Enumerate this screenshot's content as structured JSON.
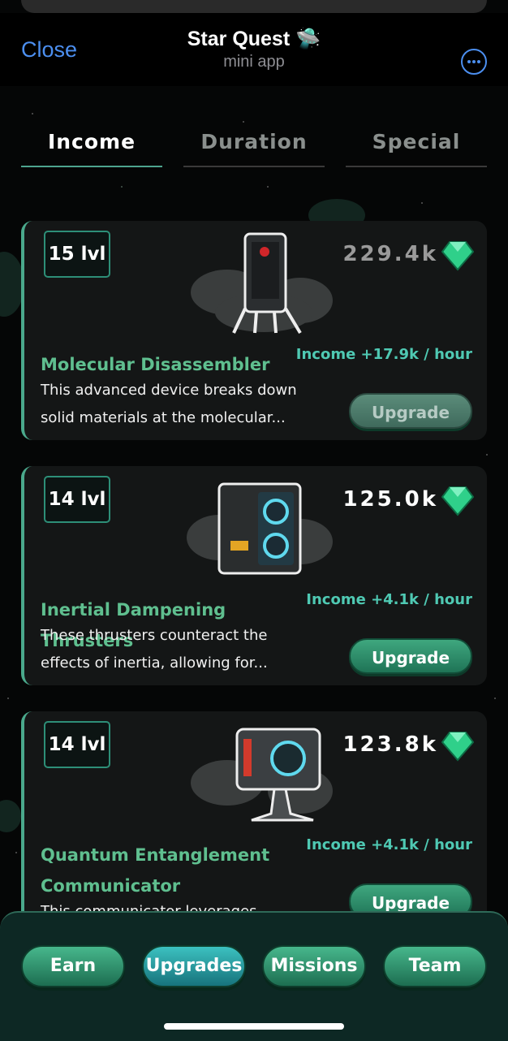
{
  "header": {
    "close_label": "Close",
    "title": "Star Quest 🛸",
    "subtitle": "mini app",
    "more_icon": "ellipsis-circle-icon"
  },
  "tabs": [
    {
      "label": "Income",
      "active": true
    },
    {
      "label": "Duration",
      "active": false
    },
    {
      "label": "Special",
      "active": false
    }
  ],
  "cards": [
    {
      "level": "15 lvl",
      "price": "229.4k",
      "income": "Income +17.9k / hour",
      "name": "Molecular Disassembler",
      "description": "This advanced device breaks down solid materials at the molecular...",
      "upgrade_label": "Upgrade",
      "upgrade_enabled": false
    },
    {
      "level": "14 lvl",
      "price": "125.0k",
      "income": "Income +4.1k / hour",
      "name": "Inertial Dampening Thrusters",
      "description": "These thrusters counteract the effects of inertia, allowing for...",
      "upgrade_label": "Upgrade",
      "upgrade_enabled": true
    },
    {
      "level": "14 lvl",
      "price": "123.8k",
      "income": "Income +4.1k / hour",
      "name": "Quantum Entanglement Communicator",
      "description": "This communicator leverages...",
      "upgrade_label": "Upgrade",
      "upgrade_enabled": true
    }
  ],
  "nav": [
    {
      "label": "Earn",
      "active": false
    },
    {
      "label": "Upgrades",
      "active": true
    },
    {
      "label": "Missions",
      "active": false
    },
    {
      "label": "Team",
      "active": false
    }
  ],
  "colors": {
    "accent": "#4aa98c",
    "link_blue": "#4c8ff0",
    "income_teal": "#4fc9b3",
    "gem_green": "#2fd08a"
  }
}
